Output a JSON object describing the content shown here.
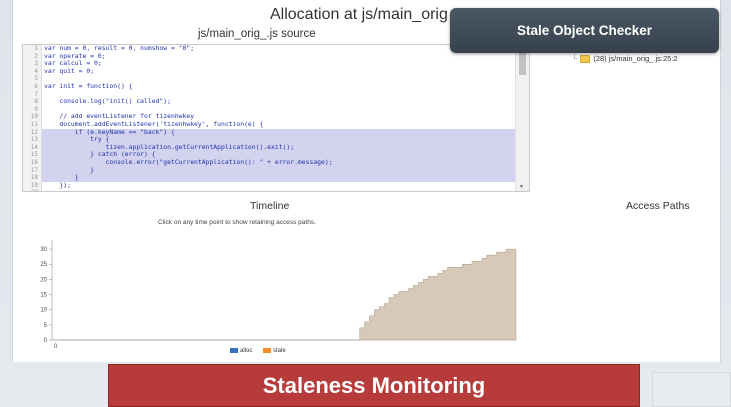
{
  "page": {
    "title": "Allocation at js/main_orig",
    "source_title": "js/main_orig_.js source"
  },
  "badge": {
    "label": "Stale Object Checker"
  },
  "tree": {
    "item": "(28) js/main_orig_.js:25:2",
    "icon": "folder-icon"
  },
  "editor": {
    "line_numbers": [
      "1",
      "2",
      "3",
      "4",
      "5",
      "6",
      "7",
      "8",
      "9",
      "10",
      "11",
      "12",
      "13",
      "14",
      "15",
      "16",
      "17",
      "18",
      "19",
      "20"
    ],
    "lines": [
      "var num = 0, result = 0, numshow = \"0\";",
      "var operate = 0;",
      "var calcul = 0;",
      "var quit = 0;",
      "",
      "var init = function() {",
      "",
      "    console.log(\"init() called\");",
      "",
      "    // add eventListener for tizenhwkey",
      "    document.addEventListener('tizenhwkey', function(e) {",
      "        if (e.keyName == \"back\") {",
      "            try {",
      "                tizen.application.getCurrentApplication().exit();",
      "            } catch (error) {",
      "                console.error(\"getCurrentApplication(): \" + error.message);",
      "            }",
      "        }",
      "    });",
      ""
    ]
  },
  "timeline": {
    "title": "Timeline",
    "hint": "Click on any time point to show retaining access paths."
  },
  "access_paths": {
    "title": "Access Paths"
  },
  "legend": [
    {
      "label": "alloc",
      "color": "#3a6fc4"
    },
    {
      "label": "stale",
      "color": "#f28c28"
    }
  ],
  "banner": {
    "label": "Staleness Monitoring"
  },
  "chart_data": {
    "type": "area",
    "x_tick_labels": [
      "0"
    ],
    "y_ticks": [
      0,
      5,
      10,
      15,
      20,
      25,
      30
    ],
    "ylim": [
      0,
      33
    ],
    "series": [
      {
        "color": "#d8c8b8",
        "values": [
          0,
          0,
          0,
          0,
          0,
          0,
          0,
          0,
          0,
          0,
          0,
          0,
          0,
          0,
          0,
          0,
          0,
          0,
          0,
          0,
          0,
          0,
          0,
          0,
          0,
          0,
          0,
          0,
          0,
          0,
          0,
          0,
          0,
          0,
          0,
          0,
          0,
          0,
          0,
          0,
          0,
          0,
          0,
          0,
          0,
          0,
          0,
          0,
          0,
          0,
          0,
          0,
          0,
          0,
          0,
          0,
          0,
          0,
          0,
          0,
          0,
          0,
          0,
          4,
          6,
          8,
          10,
          11,
          12,
          14,
          15,
          16,
          16,
          17,
          18,
          19,
          20,
          21,
          21,
          22,
          23,
          24,
          24,
          24,
          25,
          25,
          26,
          26,
          27,
          28,
          28,
          29,
          29,
          30,
          30
        ]
      }
    ],
    "legend_position": "bottom",
    "grid": false
  }
}
